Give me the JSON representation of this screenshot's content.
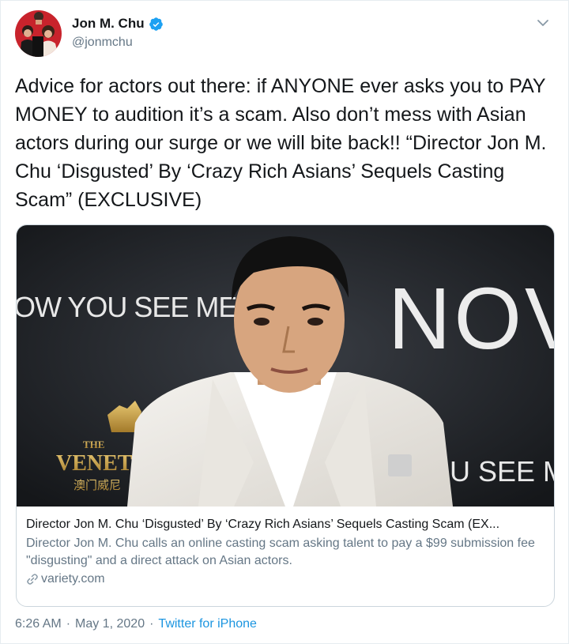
{
  "author": {
    "display_name": "Jon M. Chu",
    "handle": "@jonmchu",
    "verified_icon": "verified-badge-icon",
    "avatar_icon": "avatar"
  },
  "tweet": {
    "text": "Advice for actors out there: if ANYONE ever asks you to PAY MONEY to audition it’s a scam. Also don’t mess with Asian actors during our surge or we will bite back!! “Director Jon M. Chu ‘Disgusted’ By ‘Crazy Rich Asians’ Sequels Casting Scam” (EXCLUSIVE)"
  },
  "card": {
    "image": {
      "backdrop_left_text": "OW YOU SEE ME",
      "backdrop_right_text": "NOV",
      "backdrop_bottom_right_text": "U SEE M",
      "logo_top": "THE",
      "logo_main": "VENETI",
      "logo_sub": "澳门威尼"
    },
    "title": "Director Jon M. Chu ‘Disgusted’ By ‘Crazy Rich Asians’ Sequels Casting Scam (EX...",
    "description": "Director Jon M. Chu calls an online casting scam asking talent to pay a $99 submission fee \"disgusting\" and a direct attack on Asian actors.",
    "domain": "variety.com"
  },
  "footer": {
    "time": "6:26 AM",
    "separator": "·",
    "date": "May 1, 2020",
    "source": "Twitter for iPhone"
  },
  "colors": {
    "link": "#1b95e0",
    "verified": "#1da1f2",
    "secondary_text": "#657786"
  }
}
